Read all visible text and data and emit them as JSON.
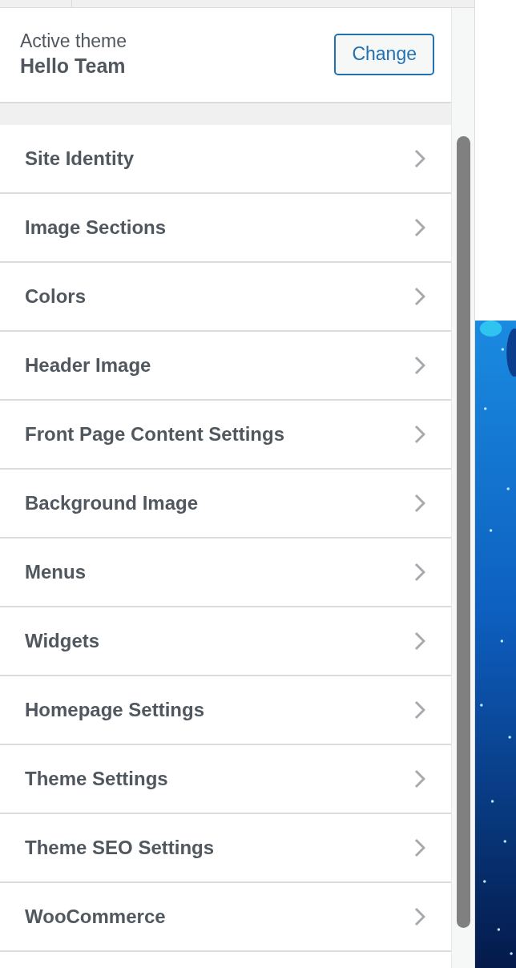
{
  "active_theme": {
    "label": "Active theme",
    "name": "Hello Team",
    "button": "Change"
  },
  "sections": [
    {
      "label": "Site Identity"
    },
    {
      "label": "Image Sections"
    },
    {
      "label": "Colors"
    },
    {
      "label": "Header Image"
    },
    {
      "label": "Front Page Content Settings"
    },
    {
      "label": "Background Image"
    },
    {
      "label": "Menus"
    },
    {
      "label": "Widgets"
    },
    {
      "label": "Homepage Settings"
    },
    {
      "label": "Theme Settings"
    },
    {
      "label": "Theme SEO Settings"
    },
    {
      "label": "WooCommerce"
    }
  ]
}
